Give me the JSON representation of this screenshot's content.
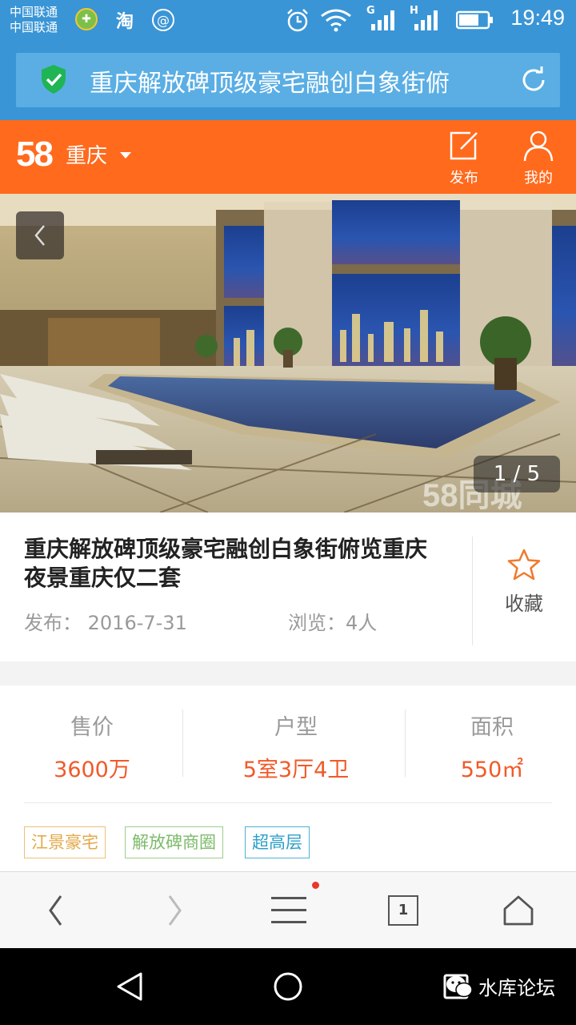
{
  "status_bar": {
    "carrier_1": "中国联通",
    "carrier_2": "中国联通",
    "taobao_glyph": "淘",
    "time": "19:49",
    "network_g": "G",
    "network_h": "H"
  },
  "address_bar": {
    "page_title": "重庆解放碑顶级豪宅融创白象街俯",
    "icons": [
      "security-shield-icon",
      "reload-icon"
    ]
  },
  "site_header": {
    "logo": "58",
    "city": "重庆",
    "publish_label": "发布",
    "mine_label": "我的"
  },
  "gallery": {
    "counter": "1 / 5",
    "watermark": "58同城"
  },
  "listing": {
    "title": "重庆解放碑顶级豪宅融创白象街俯览重庆夜景重庆仅二套",
    "publish_prefix": "发布：",
    "publish_date": "2016-7-31",
    "views_prefix": "浏览：",
    "views": "4人",
    "favorite_label": "收藏"
  },
  "stats": {
    "price_label": "售价",
    "price_value": "3600万",
    "layout_label": "户型",
    "layout_value": "5室3厅4卫",
    "area_label": "面积",
    "area_value": "550㎡"
  },
  "tags": [
    "江景豪宅",
    "解放碑商圈",
    "超高层"
  ],
  "browser_toolbar": {
    "tab_count": "1"
  },
  "nav_watermark": "水库论坛",
  "colors": {
    "status_blue": "#3a95d6",
    "brand_orange": "#ff6a1d",
    "price_orange": "#f05a28",
    "security_green": "#1fb454"
  }
}
